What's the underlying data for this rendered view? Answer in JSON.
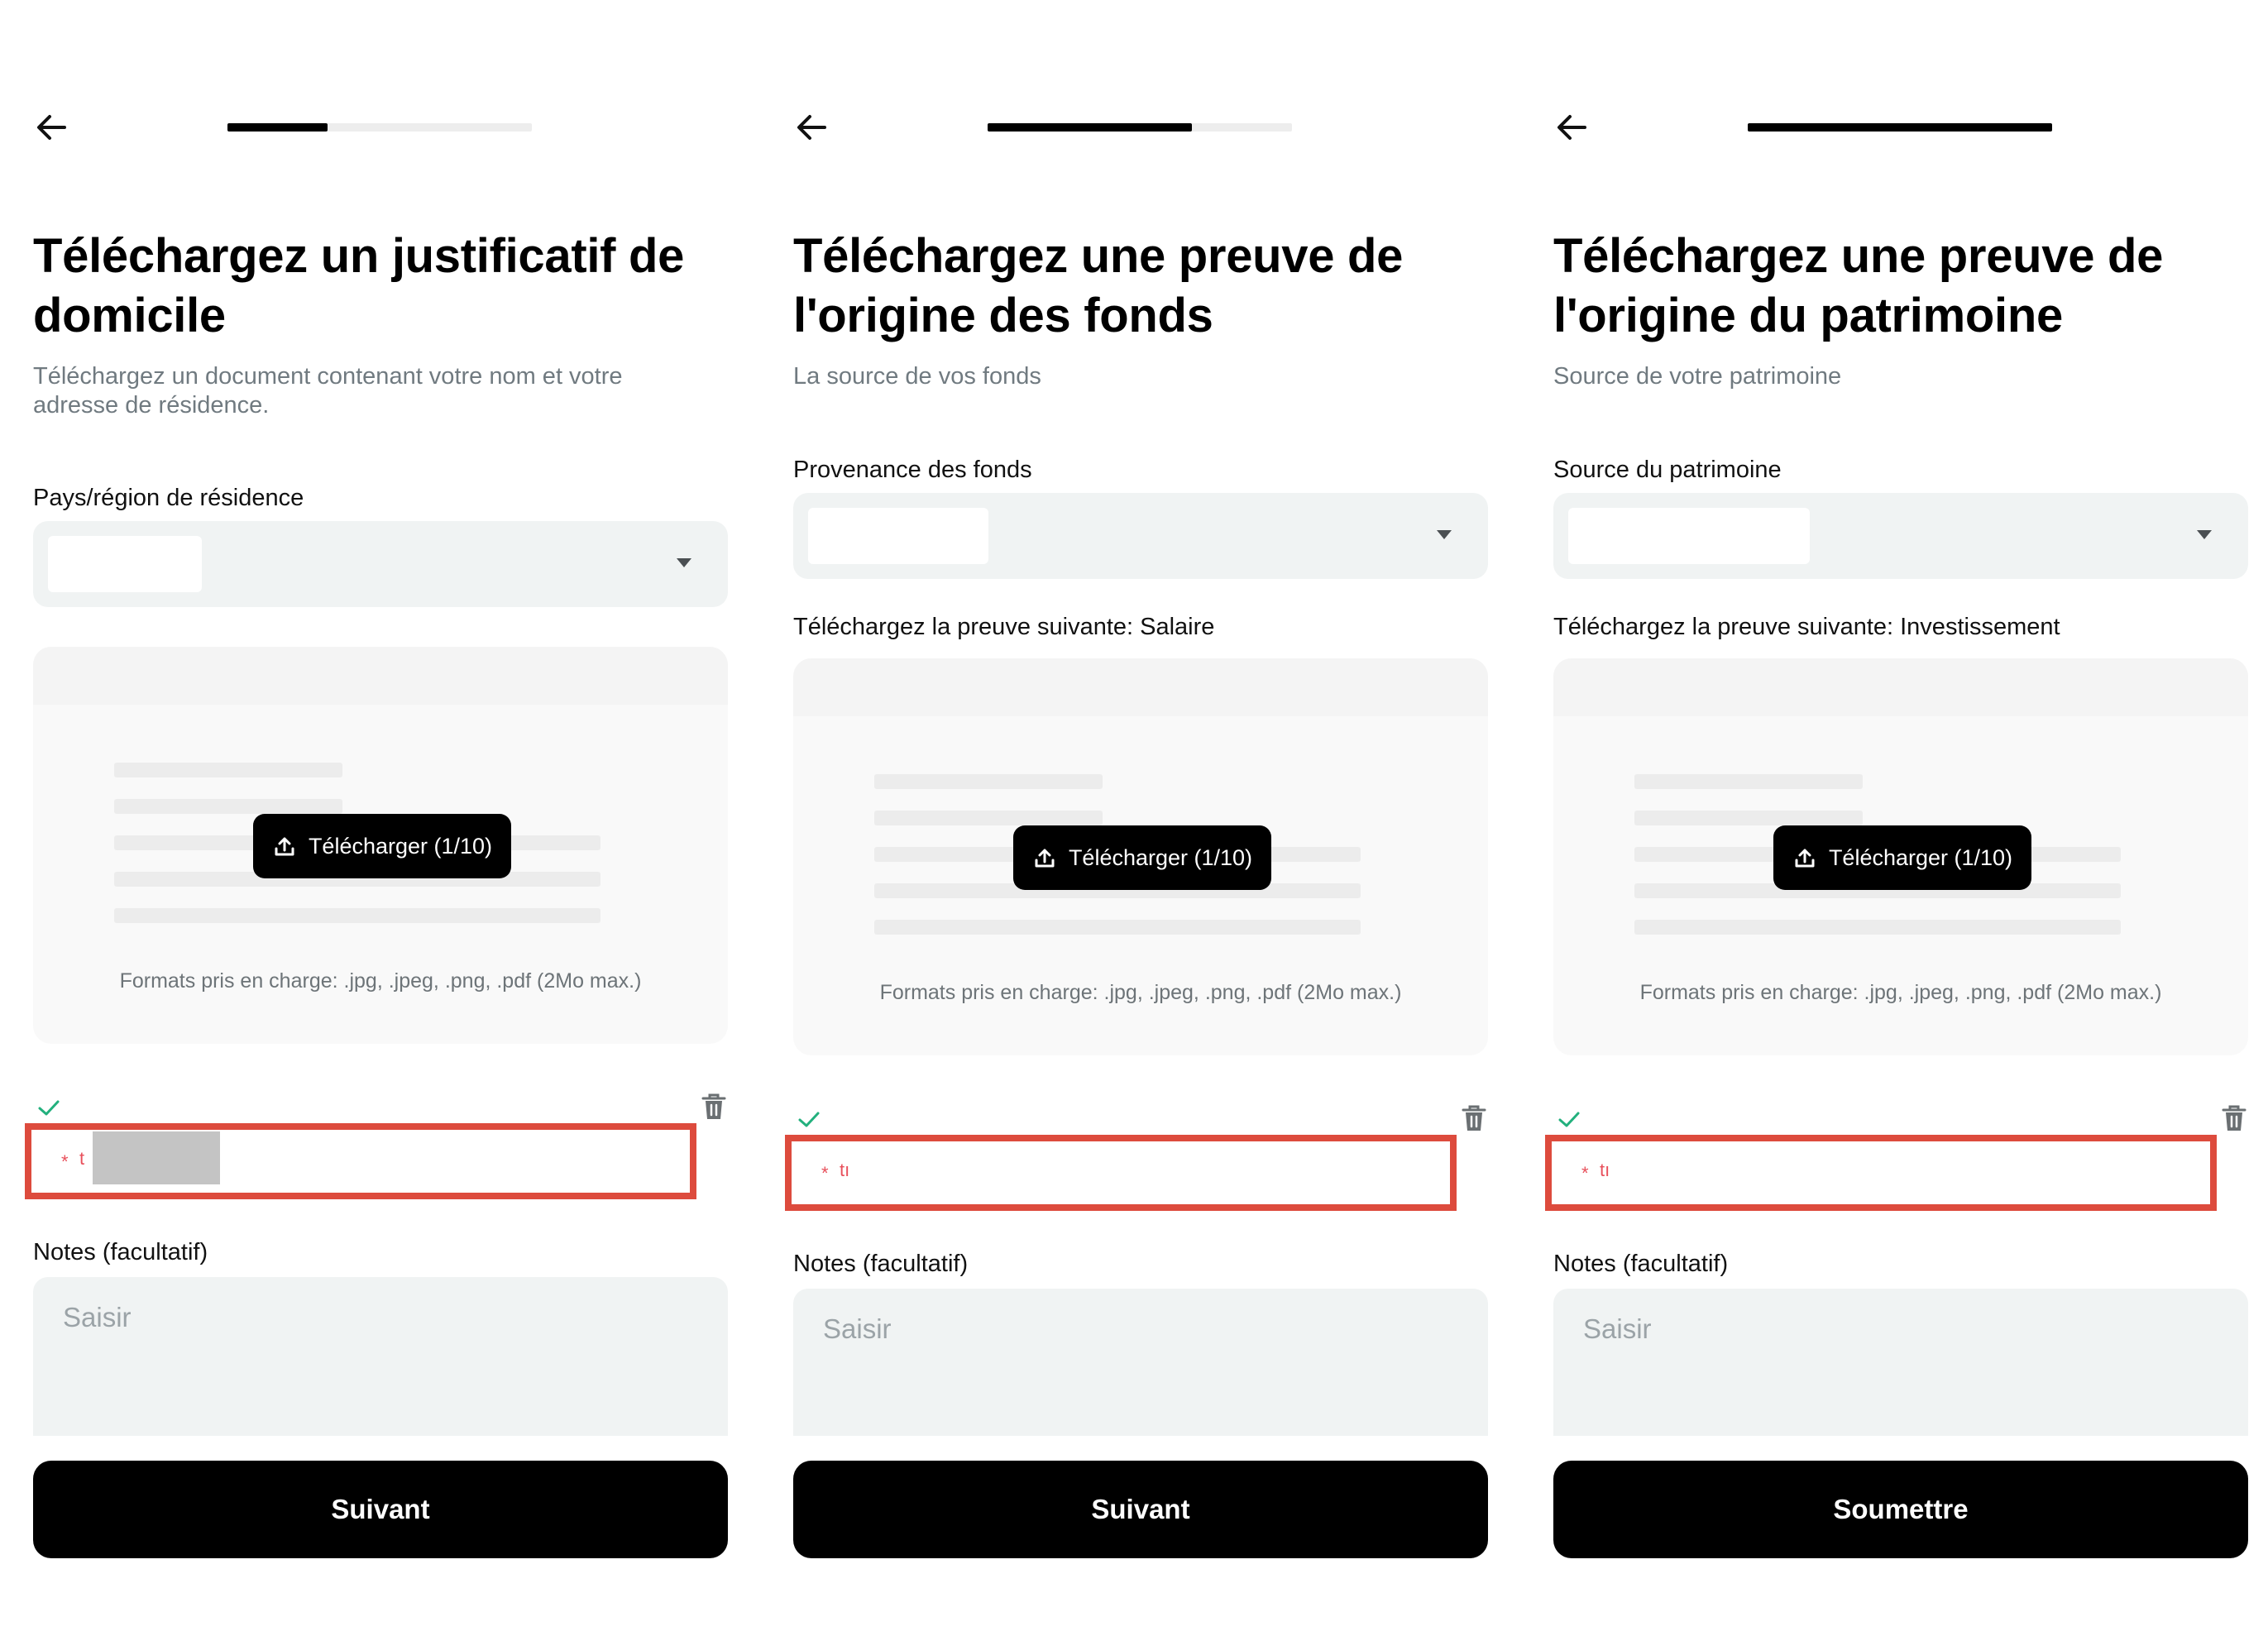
{
  "panels": [
    {
      "progress_percent": 33,
      "title": "Téléchargez un justificatif de domicile",
      "subtitle": "Téléchargez un document contenant votre nom et votre adresse de résidence.",
      "select_label": "Pays/région de résidence",
      "select_value": "",
      "upload_label": "",
      "upload_button": "Télécharger (1/10)",
      "formats_text": "Formats pris en charge: .jpg, .jpeg, .png, .pdf (2Mo max.)",
      "file_required_mark": "*",
      "file_name": "t",
      "notes_label": "Notes (facultatif)",
      "notes_placeholder": "Saisir",
      "primary_button": "Suivant"
    },
    {
      "progress_percent": 67,
      "title": "Téléchargez une preuve de l'origine des fonds",
      "subtitle": "La source de vos fonds",
      "select_label": "Provenance des fonds",
      "select_value": "",
      "upload_label": "Téléchargez la preuve suivante: Salaire",
      "upload_button": "Télécharger (1/10)",
      "formats_text": "Formats pris en charge: .jpg, .jpeg, .png, .pdf (2Mo max.)",
      "file_required_mark": "*",
      "file_name": "tı",
      "notes_label": "Notes (facultatif)",
      "notes_placeholder": "Saisir",
      "primary_button": "Suivant"
    },
    {
      "progress_percent": 100,
      "title": "Téléchargez une preuve de l'origine du patrimoine",
      "subtitle": "Source de votre patrimoine",
      "select_label": "Source du patrimoine",
      "select_value": "",
      "upload_label": "Téléchargez la preuve suivante: Investissement",
      "upload_button": "Télécharger (1/10)",
      "formats_text": "Formats pris en charge: .jpg, .jpeg, .png, .pdf (2Mo max.)",
      "file_required_mark": "*",
      "file_name": "tı",
      "notes_label": "Notes (facultatif)",
      "notes_placeholder": "Saisir",
      "primary_button": "Soumettre"
    }
  ],
  "icons": {
    "back": "arrow-left-icon",
    "upload": "upload-icon",
    "check": "check-icon",
    "trash": "trash-icon",
    "caret": "caret-down-icon"
  },
  "colors": {
    "primary": "#000000",
    "field_bg": "#f0f3f3",
    "check": "#22b07d",
    "annotation_box": "#dd4b3d",
    "required": "#e8505b"
  }
}
